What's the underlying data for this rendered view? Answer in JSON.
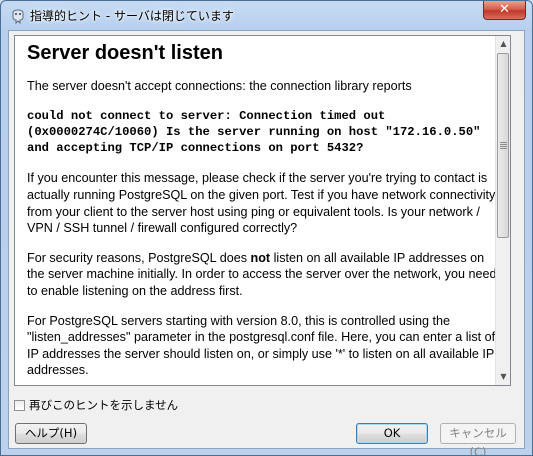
{
  "window": {
    "title": "指導的ヒント - サーバは閉じています",
    "close_label": "✕"
  },
  "hint": {
    "heading": "Server doesn't listen",
    "intro": "The server doesn't accept connections: the connection library reports",
    "error_message": "could not connect to server: Connection timed out (0x0000274C/10060) Is the server running on host \"172.16.0.50\" and accepting TCP/IP connections on port 5432?",
    "para1": "If you encounter this message, please check if the server you're trying to contact is actually running PostgreSQL on the given port. Test if you have network connectivity from your client to the server host using ping or equivalent tools. Is your network / VPN / SSH tunnel / firewall configured correctly?",
    "para2_before": "For security reasons, PostgreSQL does ",
    "para2_bold": "not",
    "para2_after": " listen on all available IP addresses on the server machine initially. In order to access the server over the network, you need to enable listening on the address first.",
    "para3": "For PostgreSQL servers starting with version 8.0, this is controlled using the \"listen_addresses\" parameter in the postgresql.conf file. Here, you can enter a list of IP addresses the server should listen on, or simply use '*' to listen on all available IP addresses."
  },
  "footer": {
    "dont_show_label": "再びこのヒントを示しません",
    "dont_show_checked": false,
    "help_label": "ヘルプ(H)",
    "ok_label": "OK",
    "cancel_label": "キャンセル(C)"
  }
}
